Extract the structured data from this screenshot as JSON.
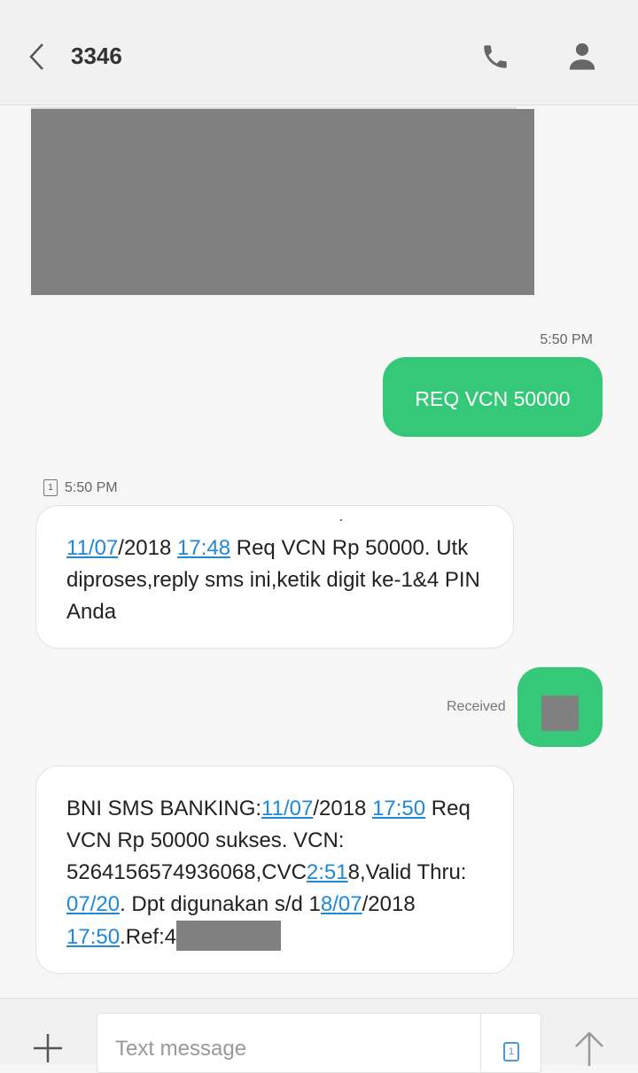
{
  "header": {
    "title": "3346",
    "back_icon": "chevron-left-icon",
    "call_icon": "phone-icon",
    "contact_icon": "person-icon"
  },
  "messages": {
    "out1": {
      "time": "5:50 PM",
      "text": "REQ VCN 50000"
    },
    "in1": {
      "sim_label": "1",
      "time": "5:50 PM",
      "date_link": "11/07",
      "year": "/2018 ",
      "time_link": "17:48",
      "rest": " Req VCN Rp 50000. Utk diproses,reply sms ini,ketik digit ke-1&4 PIN Anda"
    },
    "out2": {
      "status": "Received"
    },
    "in2": {
      "prefix": "BNI SMS BANKING:",
      "date_link": "11/07",
      "year": "/2018 ",
      "time_link": "17:50",
      "line2": " Req VCN Rp 50000 sukses. VCN: 5264156574936068,CVC",
      "cvc_link": "2:51",
      "cvc_rest": "8,Valid Thru: ",
      "valid_link": "07/20",
      "mid": ". Dpt digunakan s/d 1",
      "date2_link": "8/07",
      "year2": "/2018 ",
      "time2_link": "17:50",
      "ref": ".Ref:4"
    }
  },
  "composer": {
    "placeholder": "Text message",
    "sim_label": "1",
    "add_icon": "plus-icon",
    "send_icon": "send-arrow-icon"
  },
  "colors": {
    "outgoing_bubble": "#36c879",
    "link": "#1e88d9",
    "redaction": "#808080"
  }
}
